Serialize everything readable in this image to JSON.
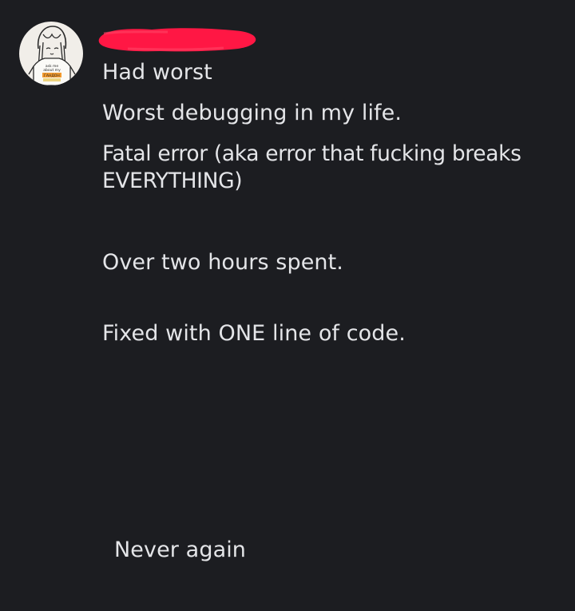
{
  "messages": [
    "Had worst",
    "Worst debugging in my life.",
    "Fatal error (aka error that fucking breaks EVERYTHING)",
    "Over two hours spent.",
    "Fixed with ONE line of code.",
    "Never again"
  ],
  "avatar": {
    "icon": "drawn-girl-avatar-icon",
    "shirt_text": "ask me about my ГАНДОН"
  },
  "colors": {
    "background": "#1c1d21",
    "text": "#e4e5e8",
    "redaction": "#ff1744",
    "avatar_bg": "#f1eee9"
  }
}
